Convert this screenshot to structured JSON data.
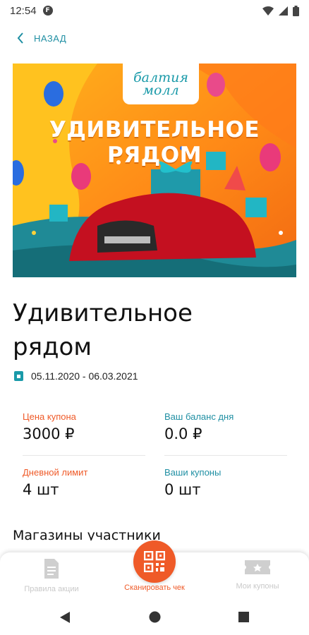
{
  "status_bar": {
    "time": "12:54",
    "app_icon_letter": "F",
    "icons": [
      "wifi-icon",
      "signal-icon",
      "battery-icon"
    ]
  },
  "header": {
    "back_label": "НАЗАД"
  },
  "banner": {
    "logo_line1": "балтия",
    "logo_line2": "молл",
    "title_line1": "УДИВИТЕЛЬНОЕ",
    "title_line2": "РЯДОМ"
  },
  "promo": {
    "title": "Удивительное рядом",
    "dates": "05.11.2020 - 06.03.2021"
  },
  "stats": {
    "coupon_price_label": "Цена купона",
    "coupon_price_value": "3000 ₽",
    "day_balance_label": "Ваш баланс дня",
    "day_balance_value": "0.0 ₽",
    "daily_limit_label": "Дневной лимит",
    "daily_limit_value": "4 шт",
    "my_coupons_label": "Ваши купоны",
    "my_coupons_value": "0 шт"
  },
  "shops_title": "Магазины участники",
  "bottom_nav": {
    "rules_label": "Правила акции",
    "scan_label": "Сканировать чек",
    "coupons_label": "Мои купоны"
  },
  "colors": {
    "accent": "#ef5a28",
    "teal": "#1f8fa3",
    "text": "#111111"
  }
}
